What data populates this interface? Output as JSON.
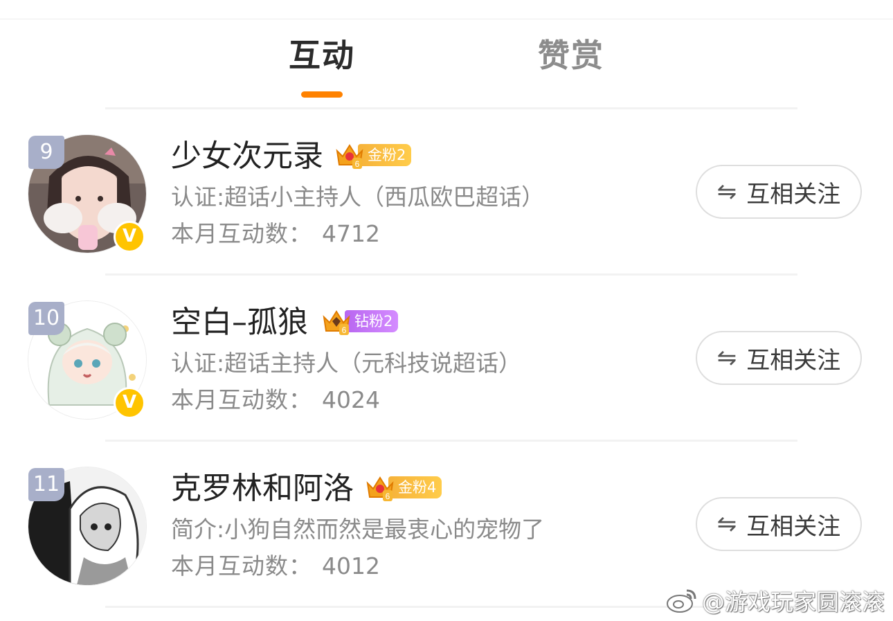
{
  "tabs": [
    {
      "label": "互动",
      "active": true
    },
    {
      "label": "赞赏",
      "active": false
    }
  ],
  "accent_color": "#ff8200",
  "users": [
    {
      "rank": "9",
      "name": "少女次元录",
      "fan_badge": {
        "level": "6",
        "label": "金粉2",
        "type": "gold"
      },
      "verified_icon": "V",
      "description": "认证:超话小主持人（西瓜欧巴超话）",
      "count_label": "本月互动数：",
      "count_value": "4712",
      "follow_label": "互相关注",
      "follow_icon": "⇋"
    },
    {
      "rank": "10",
      "name": "空白–孤狼",
      "fan_badge": {
        "level": "6",
        "label": "钻粉2",
        "type": "diamond"
      },
      "verified_icon": "V",
      "description": "认证:超话主持人（元科技说超话）",
      "count_label": "本月互动数：",
      "count_value": "4024",
      "follow_label": "互相关注",
      "follow_icon": "⇋"
    },
    {
      "rank": "11",
      "name": "克罗林和阿洛",
      "fan_badge": {
        "level": "6",
        "label": "金粉4",
        "type": "gold"
      },
      "description": "简介:小狗自然而然是最衷心的宠物了",
      "count_label": "本月互动数：",
      "count_value": "4012",
      "follow_label": "互相关注",
      "follow_icon": "⇋"
    }
  ],
  "watermark": {
    "text": "@游戏玩家圆滚滚",
    "icon": "weibo-logo-icon"
  }
}
